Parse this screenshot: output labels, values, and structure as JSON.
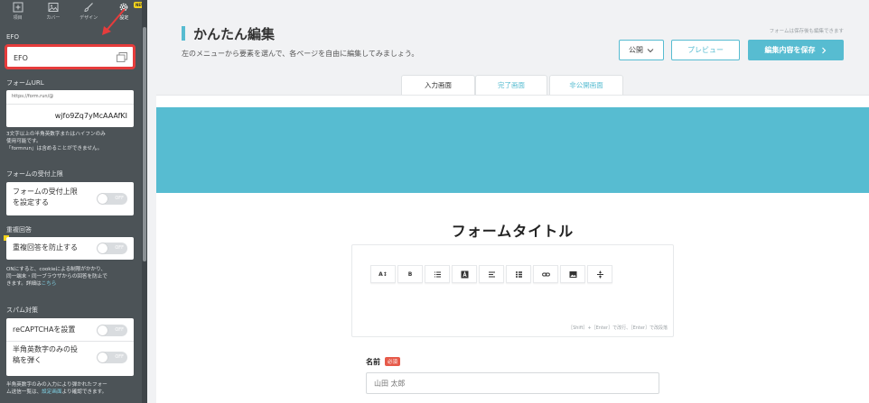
{
  "sidebar": {
    "tabs": [
      {
        "label": "項目",
        "icon": "plus-square-icon"
      },
      {
        "label": "カバー",
        "icon": "image-icon"
      },
      {
        "label": "デザイン",
        "icon": "brush-icon"
      },
      {
        "label": "設定",
        "icon": "gear-icon"
      }
    ],
    "new_badge": "NEW",
    "efo": {
      "title": "EFO",
      "value": "EFO"
    },
    "form_url": {
      "title": "フォームURL",
      "prefix": "https://form.run/@",
      "value": "wjfo9Zq7yMcAAAfKI",
      "help": [
        "3文字以上の半角英数字またはハイフンのみ",
        "使用可能です。",
        "「formrun」は含めることができません。"
      ]
    },
    "limit": {
      "title": "フォームの受付上限",
      "label_line1": "フォームの受付上限",
      "label_line2": "を設定する",
      "toggle": "OFF"
    },
    "duplicate": {
      "title": "重複回答",
      "label": "重複回答を防止する",
      "toggle": "OFF",
      "help": [
        "ONにすると、cookieによる制限がかかり、",
        "同一端末・同一ブラウザからの回答を防止で",
        "きます。詳細は"
      ],
      "help_link": "こちら"
    },
    "spam": {
      "title": "スパム対策",
      "recaptcha_label": "reCAPTCHAを設置",
      "recaptcha_toggle": "OFF",
      "ascii_line1": "半角英数字のみの投",
      "ascii_line2": "稿を弾く",
      "ascii_toggle": "OFF",
      "help_line1": "半角英数字のみの入力により弾かれたフォー",
      "help_line2_pre": "ム送信一覧は、",
      "help_link": "設定画面",
      "help_line2_post": "より確認できます。"
    }
  },
  "header": {
    "title": "かんたん編集",
    "subtitle": "左のメニューから要素を選んで、各ページを自由に編集してみましょう。",
    "save_note": "フォームは保存後も編集できます",
    "publish_label": "公開",
    "preview_label": "プレビュー",
    "save_label": "編集内容を保存"
  },
  "tabs": {
    "input": "入力画面",
    "done": "完了画面",
    "private": "非公開画面"
  },
  "form": {
    "title": "フォームタイトル",
    "toolbar": [
      "A↕",
      "B"
    ],
    "editor_hint": "［Shift］+［Enter］で改行、［Enter］で改段落",
    "field_label": "名前",
    "required": "必須",
    "name_placeholder": "山田 太郎"
  },
  "colors": {
    "accent": "#57bcd1",
    "sidebar": "#4c5357",
    "highlight": "#e63c3c",
    "badge": "#f3d31c",
    "required": "#e65a4a"
  }
}
